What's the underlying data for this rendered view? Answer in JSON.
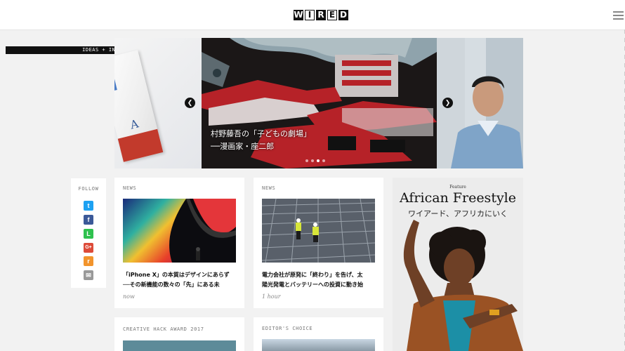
{
  "header": {
    "logo": [
      "W",
      "I",
      "R",
      "E",
      "D"
    ],
    "menu_icon": "hamburger-icon"
  },
  "hero": {
    "section_label": "IDEAS + INNOVATION",
    "caption_line1": "村野藤吾の「子どもの劇場」",
    "caption_line2": "──漫画家・座二郎",
    "prev_icon": "chevron-left-icon",
    "next_icon": "chevron-right-icon",
    "dot_count": 4,
    "active_dot": 2
  },
  "follow": {
    "title": "FOLLOW",
    "networks": [
      {
        "icon": "twitter-icon",
        "glyph": "t",
        "color": "#1da1f2"
      },
      {
        "icon": "facebook-icon",
        "glyph": "f",
        "color": "#3b5998"
      },
      {
        "icon": "line-icon",
        "glyph": "L",
        "color": "#2ec14e"
      },
      {
        "icon": "google-plus-icon",
        "glyph": "G+",
        "color": "#dd4b39"
      },
      {
        "icon": "rss-icon",
        "glyph": "r",
        "color": "#f2942c"
      },
      {
        "icon": "mail-icon",
        "glyph": "✉",
        "color": "#999999"
      }
    ]
  },
  "cards": [
    {
      "tag": "NEWS",
      "title_line1": "「iPhone X」の本質はデザインにあらず",
      "title_line2": "──その新機能の数々の「先」にある未",
      "time": "now"
    },
    {
      "tag": "NEWS",
      "title_line1": "電力会社が原発に「終わり」を告げ、太",
      "title_line2": "陽光発電とバッテリーへの投資に動き始",
      "time": "1 hour"
    },
    {
      "tag": "CREATIVE HACK AWARD 2017"
    },
    {
      "tag": "EDITOR'S CHOICE"
    }
  ],
  "feature": {
    "kicker": "Feature",
    "title": "African Freestyle",
    "subtitle": "ワイアード、アフリカにいく"
  }
}
